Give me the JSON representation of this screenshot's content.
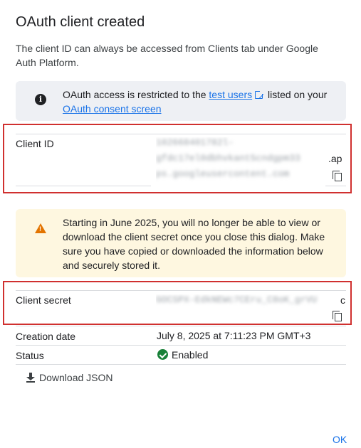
{
  "dialog": {
    "title": "OAuth client created",
    "description": "The client ID can always be accessed from Clients tab under Google Auth Platform."
  },
  "info": {
    "text_before": "OAuth access is restricted to the ",
    "link_test_users": "test users",
    "text_middle": " listed on your ",
    "link_consent": "OAuth consent screen"
  },
  "client_id": {
    "label": "Client ID",
    "value_line1": "102668401782l-",
    "value_line2": "gfdc17el0dbhvkant5cndgpm33",
    "value_suffix": ".ap",
    "value_line3": "ps.googleusercontent.com"
  },
  "warning": {
    "text": "Starting in June 2025, you will no longer be able to view or download the client secret once you close this dialog. Make sure you have copied or downloaded the information below and securely stored it."
  },
  "client_secret": {
    "label": "Client secret",
    "value": "GOCSPX-EdkNEWc7CEru_C8oK_grVU",
    "value_suffix": "c"
  },
  "creation_date": {
    "label": "Creation date",
    "value": "July 8, 2025 at 7:11:23 PM GMT+3"
  },
  "status": {
    "label": "Status",
    "value": "Enabled"
  },
  "actions": {
    "download_json": "Download JSON",
    "ok": "OK"
  },
  "colors": {
    "accent": "#1a73e8",
    "highlight_border": "#d0302f",
    "warning_bg": "#fef7e0",
    "warning_icon": "#e37400",
    "success": "#188038",
    "info_bg": "#eef0f4"
  },
  "icons": {
    "info": "info-icon",
    "warning": "warning-icon",
    "copy": "copy-icon",
    "external_link": "external-link-icon",
    "check_circle": "check-circle-icon",
    "download": "download-icon"
  }
}
